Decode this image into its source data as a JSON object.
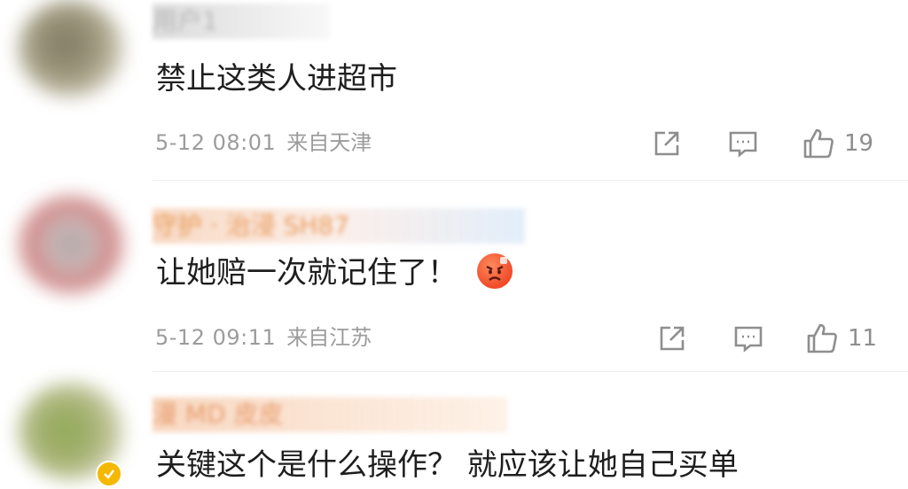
{
  "comments": [
    {
      "username": "用户1",
      "text": "禁止这类人进超市",
      "time": "5-12 08:01",
      "location": "来自天津",
      "likes": "19"
    },
    {
      "username": "守护 · 治浸 SH87",
      "text": "让她赔一次就记住了！",
      "time": "5-12 09:11",
      "location": "来自江苏",
      "likes": "11"
    },
    {
      "username": "漫 MD 皮皮",
      "text": "关键这个是什么操作？ 就应该让她自己买单"
    }
  ],
  "icons": {
    "share": "share-icon",
    "comment": "comment-icon",
    "like": "thumbs-up-icon",
    "emoji": "angry-face-emoji",
    "verified": "verified-badge-icon"
  },
  "colors": {
    "meta": "#9c9c9c",
    "text": "#1e1e1e",
    "icon": "#8e8e8e"
  }
}
